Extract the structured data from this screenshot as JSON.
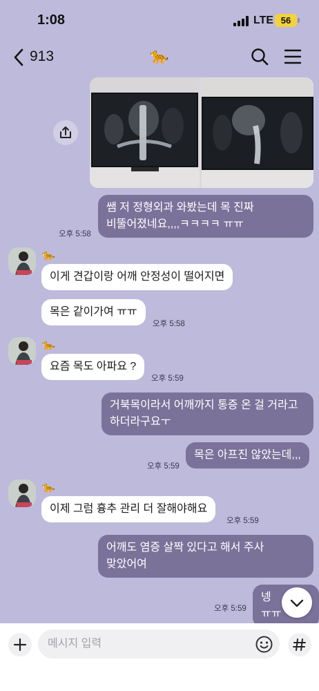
{
  "status_bar": {
    "time": "1:08",
    "network": "LTE",
    "battery": "56"
  },
  "header": {
    "back_icon": "chevron-left-icon",
    "room_count": "913",
    "room_emoji": "🐆",
    "search_icon": "search-icon",
    "menu_icon": "hamburger-menu-icon"
  },
  "colors": {
    "background": "#bdbadb",
    "my_bubble": "#7b729a",
    "their_bubble": "#ffffff",
    "battery": "#f2d23a"
  },
  "sender": {
    "emoji": "🐆"
  },
  "messages": [
    {
      "from": "me",
      "type": "photos",
      "count": 2
    },
    {
      "from": "me",
      "text": "쌤 저 정형외과 와봤는데 목 진짜 비뚤어졌네요,,,,ㅋㅋㅋㅋ ㅠㅠ",
      "time": "오후 5:58"
    },
    {
      "from": "them",
      "text": "이게 견갑이랑 어깨 안정성이 떨어지면",
      "time": ""
    },
    {
      "from": "them",
      "text": "목은 같이가여 ㅠㅠ",
      "time": "오후 5:58"
    },
    {
      "from": "them",
      "text": "요즘 목도 아파요 ?",
      "time": "오후 5:59"
    },
    {
      "from": "me",
      "text": "거북목이라서 어깨까지 통증 온 걸 거라고 하더라구요ㅜ",
      "time": ""
    },
    {
      "from": "me",
      "text": "목은 아프진 않았는데,,,",
      "time": "오후 5:59"
    },
    {
      "from": "them",
      "text": "이제 그럼 흉추 관리 더 잘해야해요",
      "time": "오후 5:59"
    },
    {
      "from": "me",
      "text": "어깨도 염증 살짝 있다고 해서 주사 맞았어여",
      "time": ""
    },
    {
      "from": "me",
      "text": "넹 ㅠㅠ",
      "time": "오후 5:59"
    }
  ],
  "input": {
    "placeholder": "메시지 입력",
    "value": ""
  },
  "icons": {
    "share": "share-icon",
    "scroll_down": "chevron-down-icon",
    "plus": "plus-icon",
    "emoji": "emoji-icon",
    "hash": "hash-icon"
  }
}
